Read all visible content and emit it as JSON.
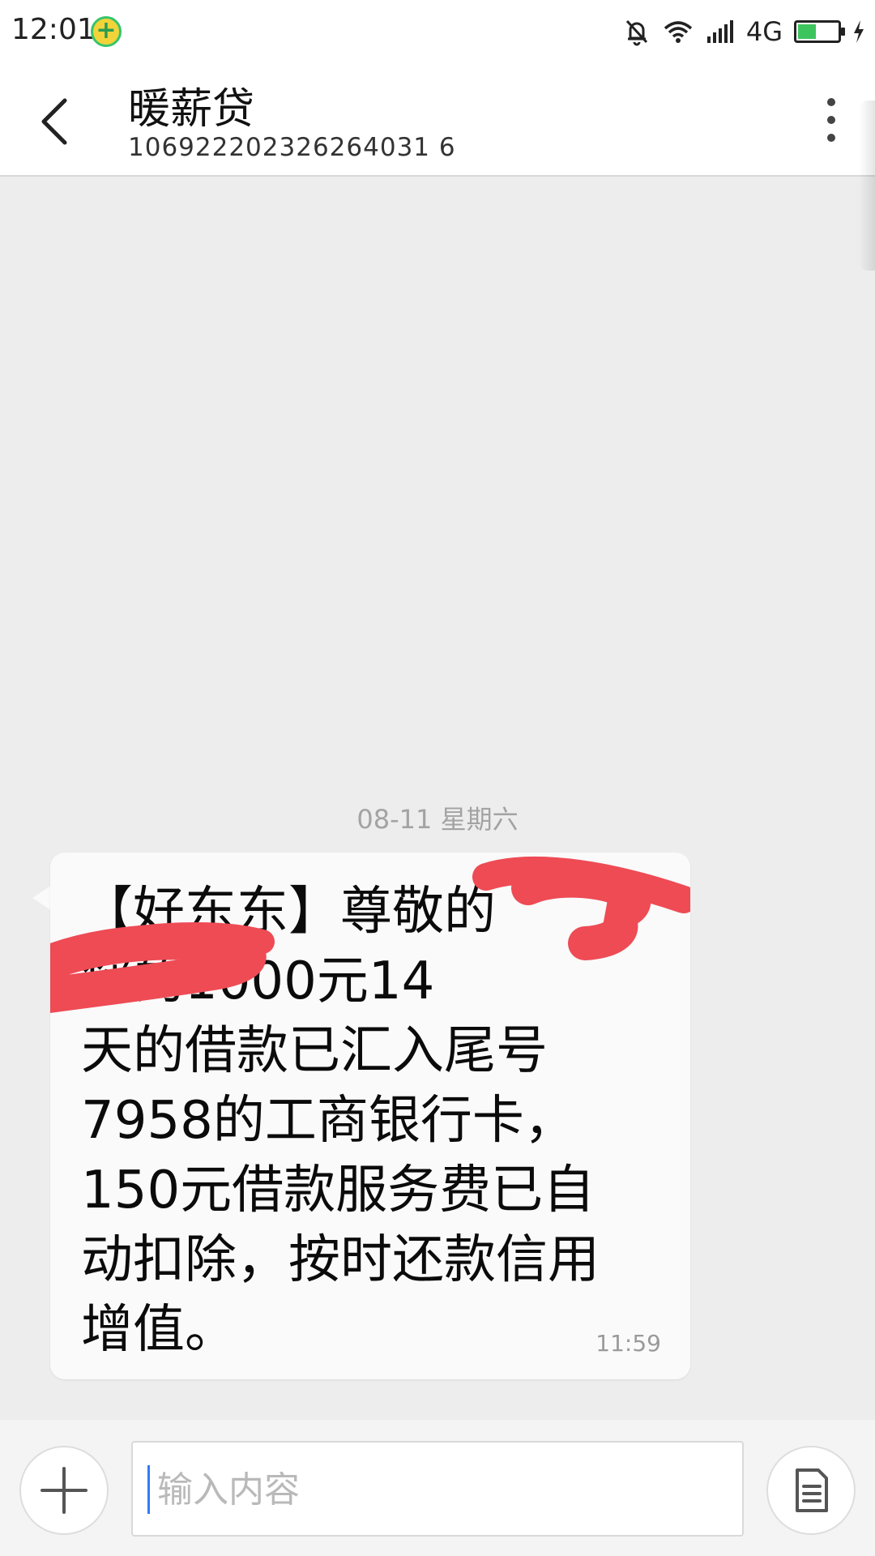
{
  "status_bar": {
    "time": "12:01",
    "network": "4G",
    "battery_level": 0.45,
    "icons": [
      "bell-muted-icon",
      "wifi-icon",
      "signal-icon",
      "battery-charging-icon"
    ]
  },
  "header": {
    "title": "暖薪贷",
    "phone_number": "10692220232626403 16",
    "phone_number_display": "106922202326264031 6"
  },
  "conversation": {
    "date_separator": "08-11  星期六",
    "messages": [
      {
        "text": "【好东东】尊敬的\n您的1000元14\n天的借款已汇入尾号\n7958的工商银行卡，\n150元借款服务费已自\n动扣除，按时还款信用\n增值。",
        "time": "11:59",
        "redacted": true
      }
    ]
  },
  "compose": {
    "placeholder": "输入内容"
  },
  "colors": {
    "redaction": "#ee4b55",
    "accent_cursor": "#2f7cf6",
    "battery": "#3ec45f"
  }
}
